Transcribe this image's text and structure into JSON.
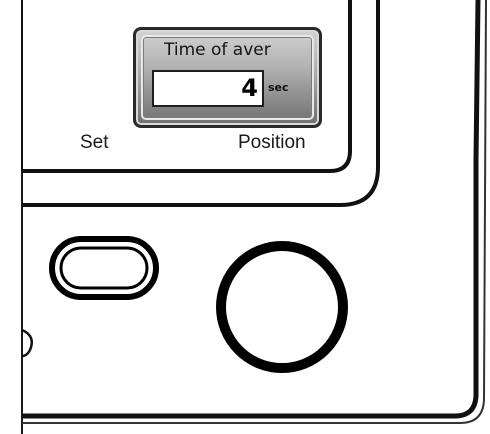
{
  "display": {
    "title": "Time of aver",
    "value": "4",
    "unit": "sec"
  },
  "softkeys": {
    "left_label": "Set",
    "right_label": "Position"
  },
  "icons": {
    "oval_button": "oval-button-icon",
    "round_button": "round-button-icon"
  }
}
